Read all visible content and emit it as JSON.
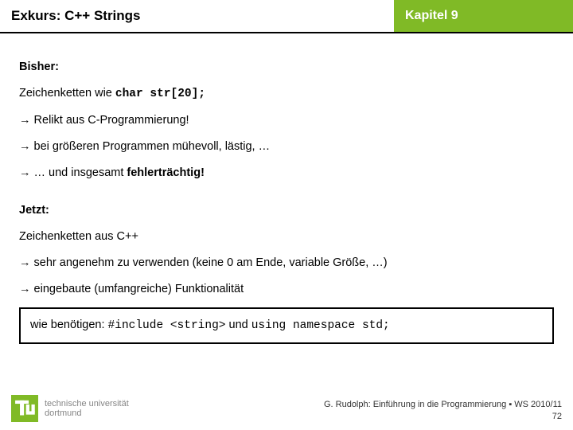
{
  "header": {
    "title": "Exkurs: C++ Strings",
    "chapter": "Kapitel 9"
  },
  "sections": {
    "old": {
      "head": "Bisher:",
      "line1_a": "Zeichenketten wie ",
      "line1_code": "char str[20];",
      "bullet1": "→ Relikt aus C-Programmierung!",
      "bullet2": "→ bei größeren Programmen mühevoll, lästig, …",
      "bullet3_a": "→ … und insgesamt ",
      "bullet3_b": "fehlerträchtig!"
    },
    "new": {
      "head": "Jetzt:",
      "line1": "Zeichenketten aus C++",
      "bullet1": "→ sehr angenehm zu verwenden (keine 0 am Ende, variable Größe, …)",
      "bullet2": "→ eingebaute (umfangreiche) Funktionalität"
    },
    "box": {
      "left": "wie benötigen:  ",
      "code1": "#include <string>",
      "mid": "  und  ",
      "code2": "using namespace std;"
    }
  },
  "footer": {
    "line1": "G. Rudolph: Einführung in die Programmierung ▪ WS 2010/11",
    "line2": "72",
    "uni1": "technische universität",
    "uni2": "dortmund"
  }
}
